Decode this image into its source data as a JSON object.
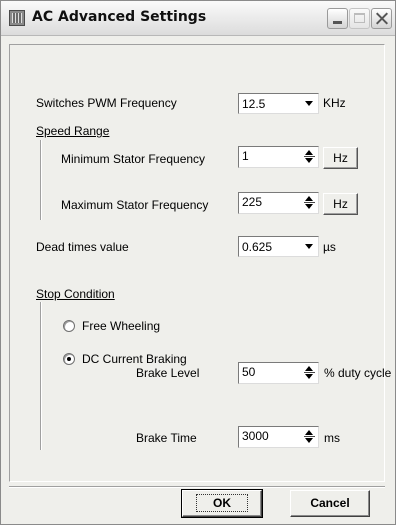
{
  "window": {
    "title": "AC Advanced Settings"
  },
  "pwm": {
    "label": "Switches PWM Frequency",
    "value": "12.5",
    "unit": "KHz"
  },
  "speed_range": {
    "heading": "Speed Range",
    "min": {
      "label": "Minimum Stator Frequency",
      "value": "1",
      "unit_button": "Hz"
    },
    "max": {
      "label": "Maximum Stator Frequency",
      "value": "225",
      "unit_button": "Hz"
    }
  },
  "dead_times": {
    "label": "Dead times value",
    "value": "0.625",
    "unit": "µs"
  },
  "stop_condition": {
    "heading": "Stop Condition",
    "options": [
      {
        "label": "Free Wheeling",
        "selected": false
      },
      {
        "label": "DC Current Braking",
        "selected": true
      }
    ],
    "brake_level": {
      "label": "Brake Level",
      "value": "50",
      "unit": "% duty cycle"
    },
    "brake_time": {
      "label": "Brake Time",
      "value": "3000",
      "unit": "ms"
    }
  },
  "buttons": {
    "ok": "OK",
    "cancel": "Cancel"
  }
}
